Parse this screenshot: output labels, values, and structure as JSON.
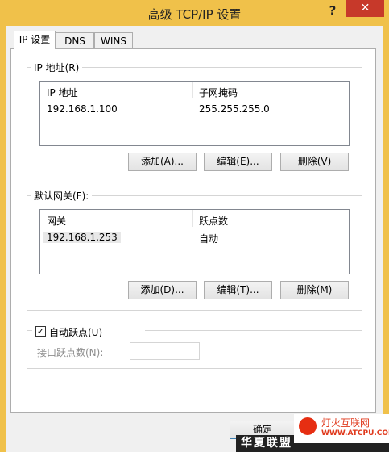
{
  "window": {
    "title": "高级 TCP/IP 设置",
    "help_glyph": "?",
    "close_glyph": "✕"
  },
  "tabs": [
    {
      "label": "IP 设置",
      "active": true
    },
    {
      "label": "DNS",
      "active": false
    },
    {
      "label": "WINS",
      "active": false
    }
  ],
  "ip_group": {
    "label": "IP 地址(R)",
    "columns": [
      "IP 地址",
      "子网掩码"
    ],
    "rows": [
      [
        "192.168.1.100",
        "255.255.255.0"
      ]
    ],
    "buttons": {
      "add": "添加(A)...",
      "edit": "编辑(E)...",
      "delete": "删除(V)"
    }
  },
  "gateway_group": {
    "label": "默认网关(F):",
    "columns": [
      "网关",
      "跃点数"
    ],
    "rows": [
      [
        "192.168.1.253",
        "自动"
      ]
    ],
    "buttons": {
      "add": "添加(D)...",
      "edit": "编辑(T)...",
      "delete": "删除(M)"
    }
  },
  "metric": {
    "checkbox_label": "自动跃点(U)",
    "checked": true,
    "interface_metric_label": "接口跃点数(N):",
    "interface_metric_value": ""
  },
  "footer": {
    "ok_label": "确定"
  },
  "watermark": {
    "banner_text": "华夏联盟",
    "logo_title": "灯火互联网",
    "logo_url": "WWW.ATCPU.COM"
  },
  "colors": {
    "titlebar": "#f0c14a",
    "close_button": "#c7392a"
  }
}
